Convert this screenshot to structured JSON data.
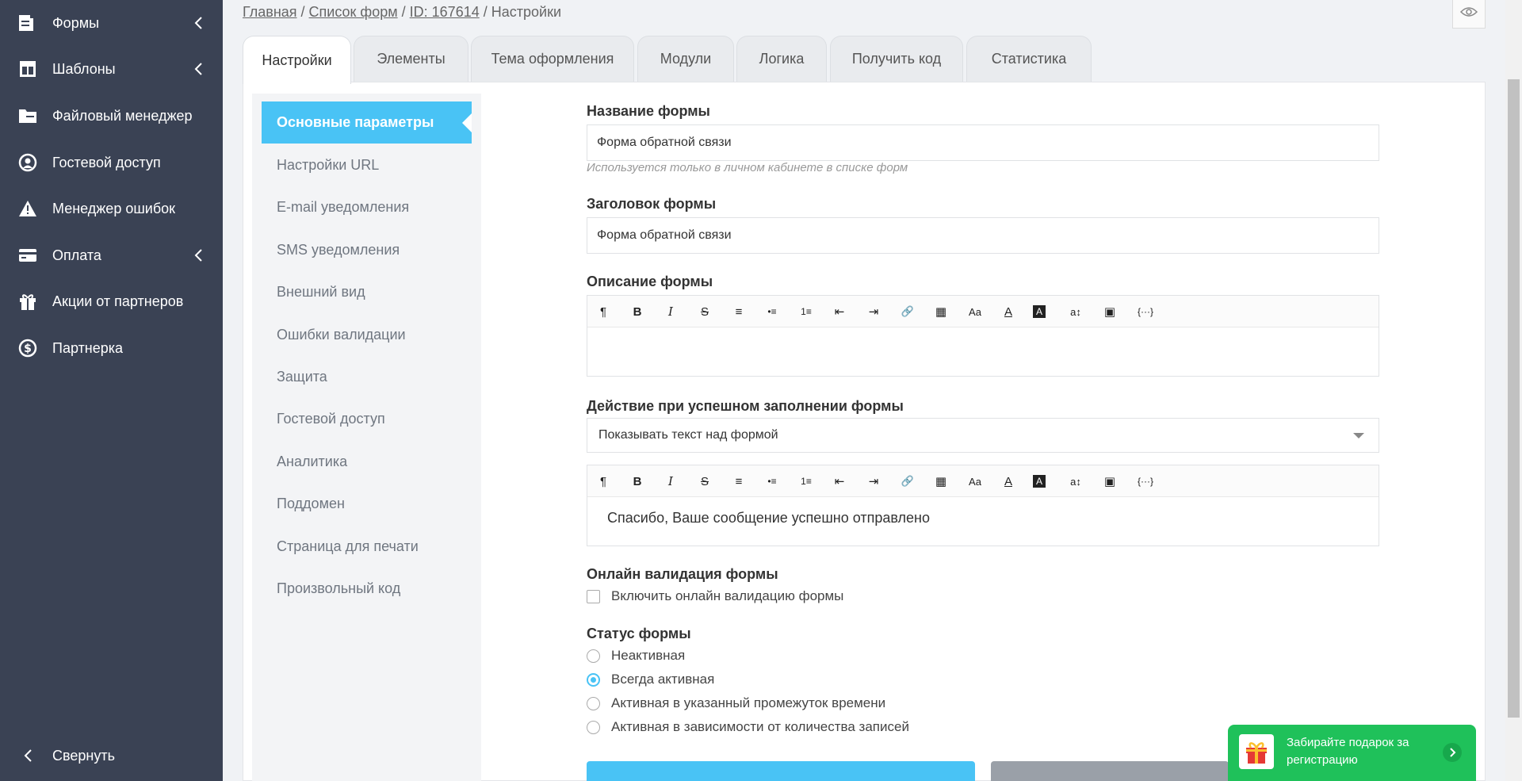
{
  "sidebar": {
    "items": [
      {
        "label": "Формы",
        "icon": "form-icon",
        "has_arrow": true
      },
      {
        "label": "Шаблоны",
        "icon": "template-icon",
        "has_arrow": true
      },
      {
        "label": "Файловый менеджер",
        "icon": "folder-icon",
        "has_arrow": false
      },
      {
        "label": "Гостевой доступ",
        "icon": "user-circle-icon",
        "has_arrow": false
      },
      {
        "label": "Менеджер ошибок",
        "icon": "warning-icon",
        "has_arrow": false
      },
      {
        "label": "Оплата",
        "icon": "credit-card-icon",
        "has_arrow": true
      },
      {
        "label": "Акции от партнеров",
        "icon": "gift-icon",
        "has_arrow": false
      },
      {
        "label": "Партнерка",
        "icon": "dollar-icon",
        "has_arrow": false
      }
    ],
    "collapse_label": "Свернуть"
  },
  "breadcrumb": {
    "home": "Главная",
    "sep": " / ",
    "list": "Список форм",
    "id": "ID: 167614",
    "current": "Настройки"
  },
  "tabs": [
    "Настройки",
    "Элементы",
    "Тема оформления",
    "Модули",
    "Логика",
    "Получить код",
    "Статистика"
  ],
  "subnav": [
    "Основные параметры",
    "Настройки URL",
    "E-mail уведомления",
    "SMS уведомления",
    "Внешний вид",
    "Ошибки валидации",
    "Защита",
    "Гостевой доступ",
    "Аналитика",
    "Поддомен",
    "Страница для печати",
    "Произвольный код"
  ],
  "form": {
    "name_label": "Название формы",
    "name_value": "Форма обратной связи",
    "name_hint": "Используется только в личном кабинете в списке форм",
    "header_label": "Заголовок формы",
    "header_value": "Форма обратной связи",
    "desc_label": "Описание формы",
    "action_label": "Действие при успешном заполнении формы",
    "action_value": "Показывать текст над формой",
    "success_text": "Спасибо, Ваше сообщение успешно отправлено",
    "validation_label": "Онлайн валидация формы",
    "validation_checkbox": "Включить онлайн валидацию формы",
    "status_label": "Статус формы",
    "status_options": [
      "Неактивная",
      "Всегда активная",
      "Активная в указанный промежуток времени",
      "Активная в зависимости от количества записей"
    ],
    "status_selected": 1
  },
  "toolbar_glyphs": [
    "¶",
    "B",
    "I",
    "S",
    "≡",
    "•≡",
    "1≡",
    "⇤",
    "⇥",
    "🔗",
    "▦",
    "Aa",
    "A",
    "A",
    "a↕",
    "▣",
    "{···}"
  ],
  "promo": {
    "text": "Забирайте подарок за регистрацию"
  },
  "colors": {
    "sidebar_bg": "#3a4254",
    "accent": "#49c3f5",
    "promo": "#1fc15a"
  }
}
